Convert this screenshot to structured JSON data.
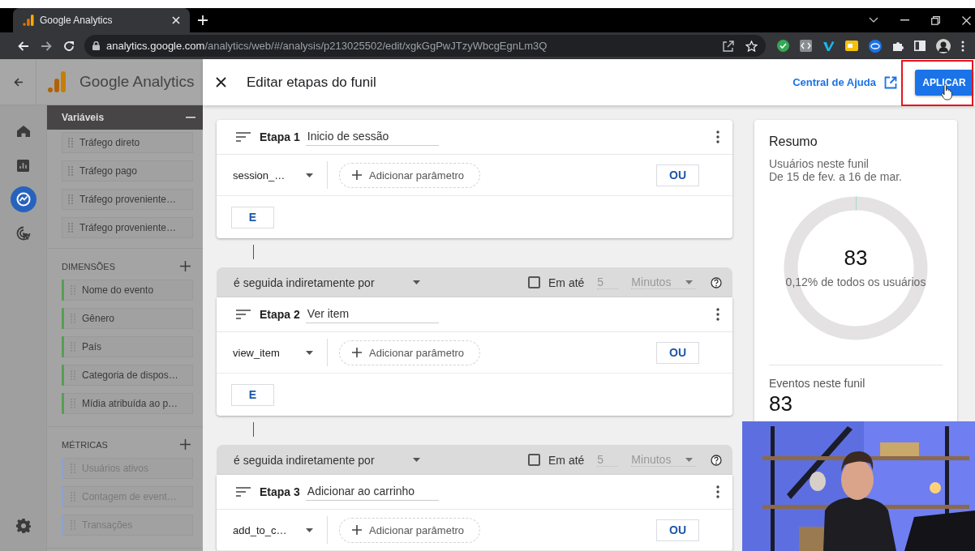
{
  "browser": {
    "tab_title": "Google Analytics",
    "url_host": "analytics.google.com",
    "url_path": "/analytics/web/#/analysis/p213025502/edit/xgkGgPwJTzyWbcgEgnLm3Q"
  },
  "app": {
    "brand": "Google Analytics",
    "rail": [
      {
        "kind": "home",
        "selected": false
      },
      {
        "kind": "reports",
        "selected": false
      },
      {
        "kind": "explore",
        "selected": true
      },
      {
        "kind": "advertising",
        "selected": false
      }
    ]
  },
  "variables": {
    "title": "Variáveis",
    "segments": [
      "Tráfego direto",
      "Tráfego pago",
      "Tráfego proveniente…",
      "Tráfego proveniente…"
    ],
    "sections": [
      {
        "kind": "dimensions",
        "title": "DIMENSÕES",
        "color": "#55a052",
        "items": [
          "Nome do evento",
          "Gênero",
          "País",
          "Categoria de dispos…",
          "Mídia atribuída ao p…"
        ]
      },
      {
        "kind": "metrics",
        "title": "MÉTRICAS",
        "color": "#8da2cc",
        "items": [
          "Usuários ativos",
          "Contagem de event…",
          "Transações"
        ]
      }
    ]
  },
  "dialog": {
    "title": "Editar etapas do funil",
    "help_link": "Central de Ajuda",
    "apply_button": "APLICAR",
    "apply_highlighted": true
  },
  "steps": [
    {
      "label": "Etapa 1",
      "name": "Inicio de sessão",
      "event": "session_…",
      "add_param": "Adicionar parâmetro",
      "or_button": "OU",
      "and_button": "E"
    },
    {
      "connector": {
        "relation": "é seguida indiretamente por",
        "within_checked": false,
        "within_label": "Em até",
        "within_value": "5",
        "within_unit": "Minutos"
      },
      "label": "Etapa 2",
      "name": "Ver item",
      "event": "view_item",
      "add_param": "Adicionar parâmetro",
      "or_button": "OU",
      "and_button": "E"
    },
    {
      "connector": {
        "relation": "é seguida indiretamente por",
        "within_checked": false,
        "within_label": "Em até",
        "within_value": "5",
        "within_unit": "Minutos"
      },
      "label": "Etapa 3",
      "name": "Adicionar ao carrinho",
      "event": "add_to_c…",
      "add_param": "Adicionar parâmetro",
      "or_button": "OU"
    }
  ],
  "summary": {
    "title": "Resumo",
    "users_label": "Usuários neste funil",
    "date_range": "De 15 de fev. a 16 de mar.",
    "users_value": "83",
    "users_share": "0,12% de todos os usuários",
    "level": 0.0012,
    "events_label": "Eventos neste funil",
    "events_value": "83"
  }
}
